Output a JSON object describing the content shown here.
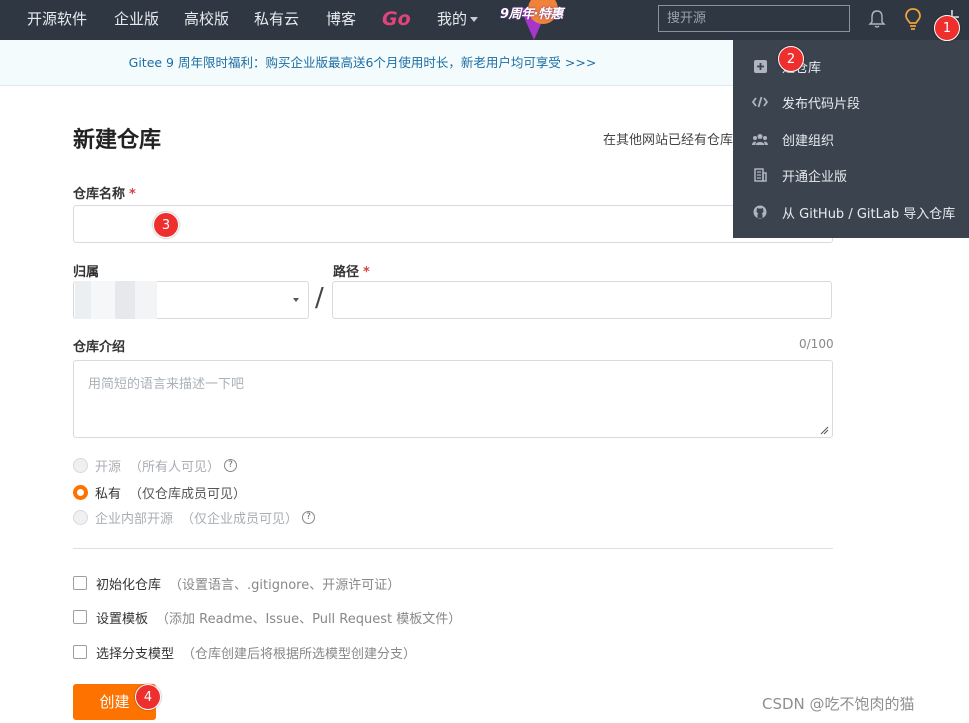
{
  "nav": {
    "items": [
      "开源软件",
      "企业版",
      "高校版",
      "私有云",
      "博客"
    ],
    "go_label": "Go",
    "mine_label": "我的",
    "anniversary_text": "9周年·特惠",
    "search_placeholder": "搜开源",
    "icons": [
      "bell-icon",
      "lightbulb-icon",
      "plus-icon"
    ]
  },
  "notice": {
    "text": "Gitee 9 周年限时福利：购买企业版最高送6个月使用时长，新老用户均可享受 >>>"
  },
  "form": {
    "title": "新建仓库",
    "import_hint": "在其他网站已经有仓库",
    "repo_name_label": "仓库名称",
    "required_mark": "*",
    "owner_label": "归属",
    "path_label": "路径",
    "path_separator": "/",
    "intro_label": "仓库介绍",
    "intro_counter": "0/100",
    "intro_placeholder": "用简短的语言来描述一下吧",
    "visibility": [
      {
        "label": "开源",
        "hint": "（所有人可见）",
        "checked": false,
        "disabled": true,
        "help": true
      },
      {
        "label": "私有",
        "hint": "（仅仓库成员可见）",
        "checked": true,
        "disabled": false,
        "help": false
      },
      {
        "label": "企业内部开源",
        "hint": "（仅企业成员可见）",
        "checked": false,
        "disabled": true,
        "help": true
      }
    ],
    "options": [
      {
        "label": "初始化仓库",
        "hint": "（设置语言、.gitignore、开源许可证）"
      },
      {
        "label": "设置模板",
        "hint": "（添加 Readme、Issue、Pull Request 模板文件）"
      },
      {
        "label": "选择分支模型",
        "hint": "（仓库创建后将根据所选模型创建分支）"
      }
    ],
    "help_glyph": "?",
    "create_label": "创建"
  },
  "dropdown": {
    "items": [
      {
        "icon": "plus-square-icon",
        "label": "建仓库"
      },
      {
        "icon": "code-icon",
        "label": "发布代码片段"
      },
      {
        "icon": "group-icon",
        "label": "创建组织"
      },
      {
        "icon": "building-icon",
        "label": "开通企业版"
      },
      {
        "icon": "github-icon",
        "label": "从 GitHub / GitLab 导入仓库"
      }
    ]
  },
  "markers": [
    "1",
    "2",
    "3",
    "4"
  ],
  "watermark": "CSDN @吃不饱肉的猫",
  "colors": {
    "nav_bg": "#2e3742",
    "accent": "#fe7300",
    "marker": "#ef2e2e",
    "notice_text": "#1c6ea4",
    "go": "#e1447a"
  }
}
